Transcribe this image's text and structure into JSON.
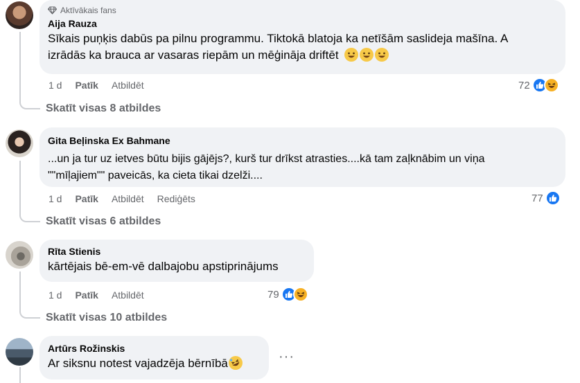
{
  "comments": [
    {
      "badge": "Aktīvākais fans",
      "author": "Aija Rauza",
      "text_line1": "Sīkais puņķis dabūs pa pilnu programmu. Tiktokā blatoja ka netīšām saslideja mašīna. A",
      "text_line2": "izrādās ka brauca ar vasaras riepām un mēģināja driftēt",
      "time": "1 d",
      "like_label": "Patīk",
      "reply_label": "Atbildēt",
      "reaction_count": "72",
      "view_replies": "Skatīt visas 8 atbildes"
    },
    {
      "author": "Gita Beļinska Ex Bahmane",
      "text_line1": "...un ja tur uz ietves būtu bijis gājējs?, kurš tur drīkst atrasties....kā tam zaļknābim un viņa",
      "text_line2": "\"\"mīļajiem\"\" paveicās, ka cieta tikai dzelži....",
      "time": "1 d",
      "like_label": "Patīk",
      "reply_label": "Atbildēt",
      "edited_label": "Rediģēts",
      "reaction_count": "77",
      "view_replies": "Skatīt visas 6 atbildes"
    },
    {
      "author": "Rīta Stienis",
      "text_line1": "kārtējais bē-em-vē dalbajobu apstiprinājums",
      "time": "1 d",
      "like_label": "Patīk",
      "reply_label": "Atbildēt",
      "reaction_count": "79",
      "view_replies": "Skatīt visas 10 atbildes"
    },
    {
      "author": "Artūrs Rožinskis",
      "text_line1": "Ar siksnu notest vajadzēja bērnībā",
      "more": "···"
    }
  ],
  "colors": {
    "bubble": "#f0f2f5",
    "secondary_text": "#65676b",
    "like_blue": "#1877f2",
    "haha_yellow": "#f7b125",
    "thread_line": "#ced0d4"
  },
  "icons": [
    "gem-icon",
    "like-reaction-icon",
    "haha-reaction-icon",
    "grin-emoji",
    "rofl-emoji",
    "more-dots-icon"
  ]
}
